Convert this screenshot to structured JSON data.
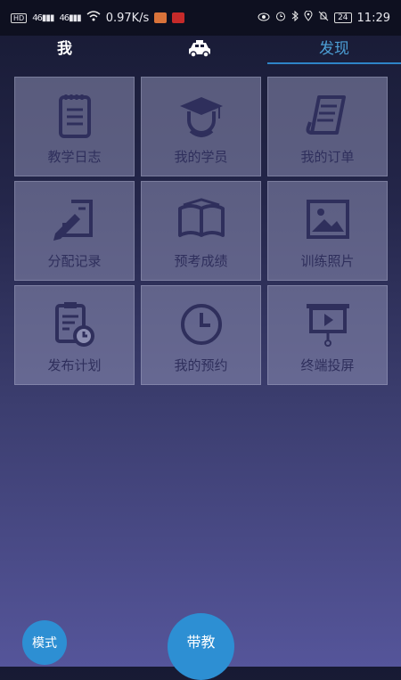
{
  "status_bar": {
    "left_items": [
      "HD",
      "46",
      "46"
    ],
    "network_speed": "0.97K/s",
    "battery": "24",
    "time": "11:29"
  },
  "top_nav": {
    "left_label": "我",
    "center_icon": "car-icon",
    "right_label": "发现",
    "active_color": "#4c9fd6"
  },
  "tiles": [
    {
      "label": "教学日志",
      "icon": "notebook-icon"
    },
    {
      "label": "我的学员",
      "icon": "graduate-icon"
    },
    {
      "label": "我的订单",
      "icon": "order-list-icon"
    },
    {
      "label": "分配记录",
      "icon": "edit-note-icon"
    },
    {
      "label": "预考成绩",
      "icon": "open-book-icon"
    },
    {
      "label": "训练照片",
      "icon": "picture-icon"
    },
    {
      "label": "发布计划",
      "icon": "clipboard-timer-icon"
    },
    {
      "label": "我的预约",
      "icon": "clock-icon"
    },
    {
      "label": "终端投屏",
      "icon": "projector-play-icon"
    }
  ],
  "bottom": {
    "mode_button": "模式",
    "teach_button": "带教",
    "button_color": "#2d8fd3"
  }
}
